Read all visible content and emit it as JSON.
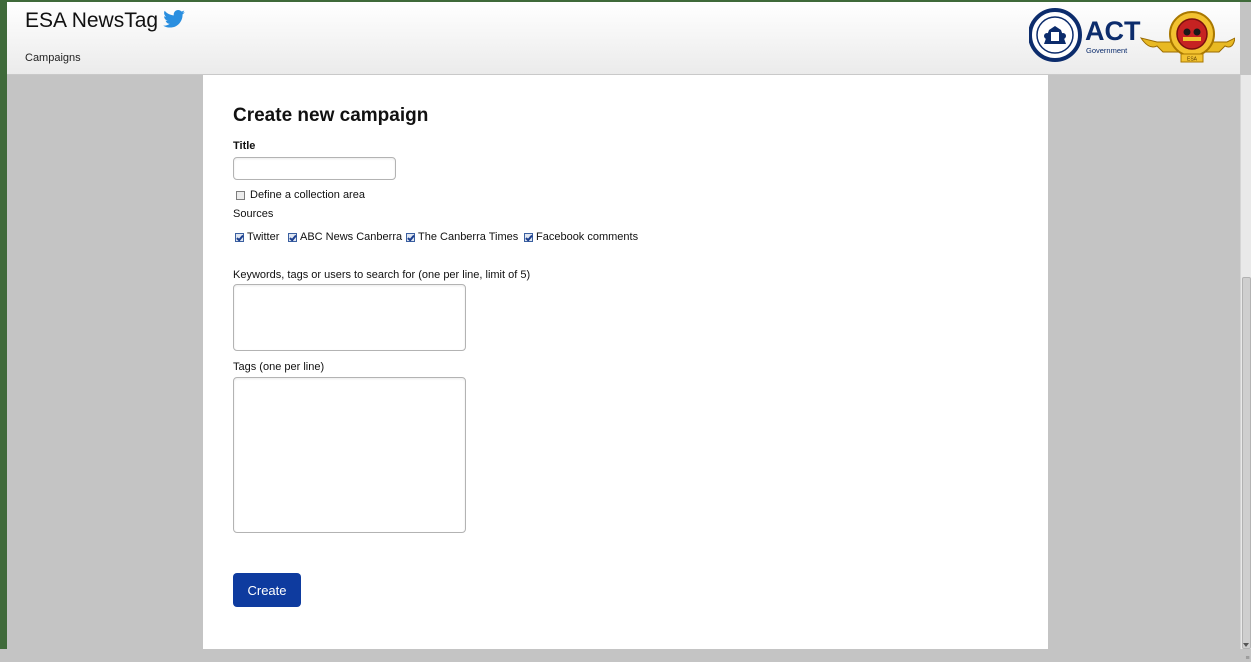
{
  "header": {
    "app_title": "ESA NewsTag",
    "nav": {
      "campaigns": "Campaigns"
    },
    "logo": {
      "text": "ACT",
      "subtext": "Government",
      "crest_text": "ESA"
    },
    "twitter_icon": "twitter-bird-icon"
  },
  "form": {
    "heading": "Create new campaign",
    "title_label": "Title",
    "title_value": "",
    "collection_area_label": "Define a collection area",
    "collection_area_checked": false,
    "sources_label": "Sources",
    "sources": [
      {
        "label": "Twitter",
        "checked": true
      },
      {
        "label": "ABC News Canberra",
        "checked": true
      },
      {
        "label": "The Canberra Times",
        "checked": true
      },
      {
        "label": "Facebook comments",
        "checked": true
      }
    ],
    "keywords_label": "Keywords, tags or users to search for (one per line, limit of 5)",
    "keywords_value": "",
    "tags_label": "Tags (one per line)",
    "tags_value": "",
    "create_button": "Create"
  },
  "colors": {
    "accent_button": "#0e3b9f",
    "twitter_blue": "#2a8fe0",
    "logo_navy": "#0c2c6c",
    "page_background": "#c4c4c4"
  }
}
